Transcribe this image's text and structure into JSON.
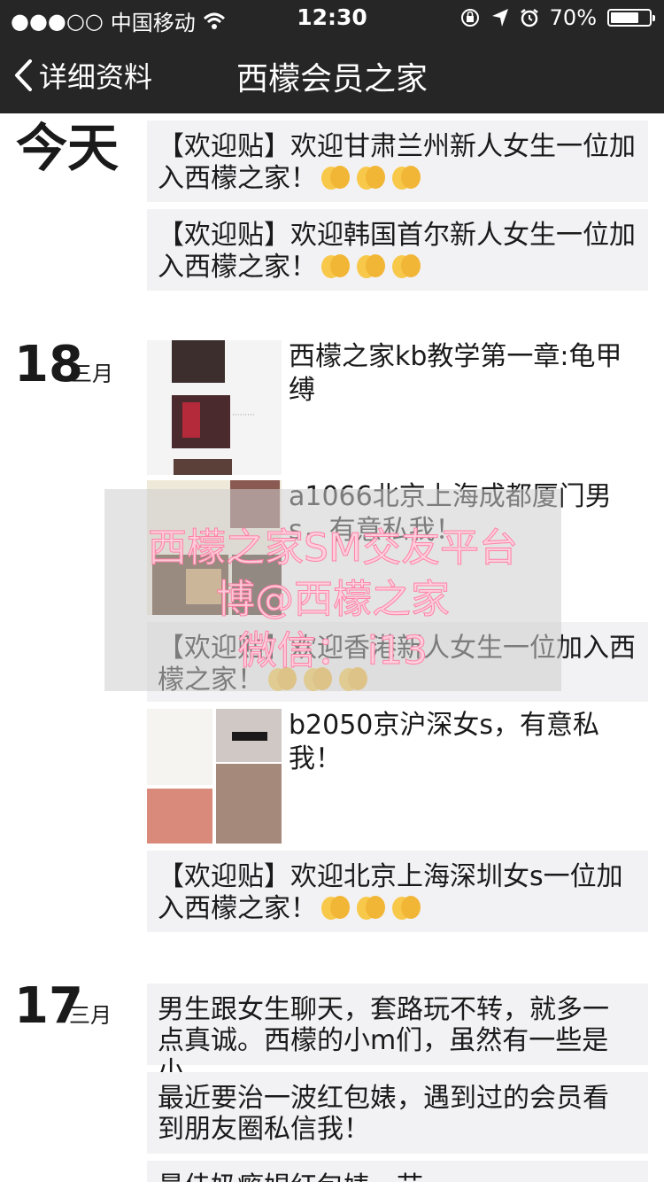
{
  "status_bar": {
    "signal": "●●●○○",
    "carrier": "中国移动",
    "time": "12:30",
    "battery": "70%"
  },
  "nav": {
    "back_label": "详细资料",
    "title": "西檬会员之家"
  },
  "sections": [
    {
      "date_label": "今天",
      "posts": [
        {
          "text": "【欢迎贴】欢迎甘肃兰州新人女生一位加入西檬之家！"
        },
        {
          "text": "【欢迎贴】欢迎韩国首尔新人女生一位加入西檬之家！"
        }
      ]
    },
    {
      "day": "18",
      "month": "三月",
      "posts": [
        {
          "text": "西檬之家kb教学第一章:龟甲缚"
        },
        {
          "text": "a1066北京上海成都厦门男s，有意私我！"
        },
        {
          "text": "【欢迎贴】欢迎香港新人女生一位加入西檬之家！"
        },
        {
          "text": "b2050京沪深女s，有意私我！"
        },
        {
          "text": "【欢迎贴】欢迎北京上海深圳女s一位加入西檬之家！"
        }
      ]
    },
    {
      "day": "17",
      "month": "三月",
      "posts": [
        {
          "text": "男生跟女生聊天，套路玩不转，就多一点真诚。西檬的小m们，虽然有一些是小…"
        },
        {
          "text": "最近要治一波红包婊，遇到过的会员看到朋友圈私信我！"
        },
        {
          "text": "最佳奶瘾娼红包婊一节"
        }
      ]
    }
  ],
  "watermark": {
    "line1": "西檬之家SM交友平台",
    "line2": "博@西檬之家",
    "line3": "微信：   i13"
  },
  "icons": [
    "back-chevron-icon",
    "wifi-icon",
    "location-arrow-icon",
    "alarm-icon",
    "orientation-lock-icon",
    "clapping-hands-icon"
  ]
}
